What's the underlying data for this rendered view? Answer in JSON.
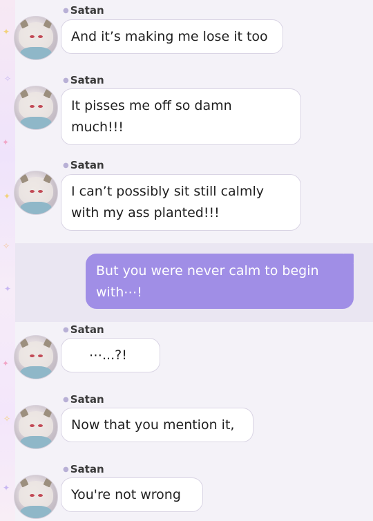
{
  "chat": {
    "messages": [
      {
        "sender": "Satan",
        "text": "And it’s making me lose it too"
      },
      {
        "sender": "Satan",
        "text": "It pisses me off so damn\nmuch!!!"
      },
      {
        "sender": "Satan",
        "text": "I can’t possibly sit still calmly\nwith my ass planted!!!"
      },
      {
        "sender": "",
        "text": "But you were never calm to begin\nwith⋯!"
      },
      {
        "sender": "Satan",
        "text": "⋯...?!"
      },
      {
        "sender": "Satan",
        "text": "Now that you mention it,"
      },
      {
        "sender": "Satan",
        "text": "You're not wrong"
      }
    ]
  },
  "colors": {
    "own_bubble": "#a08ee6",
    "other_bubble": "#ffffff",
    "sender_dot": "#b8b0d6"
  },
  "icons": [
    "avatar-satan",
    "sparkle-icon",
    "sender-dot-icon"
  ]
}
